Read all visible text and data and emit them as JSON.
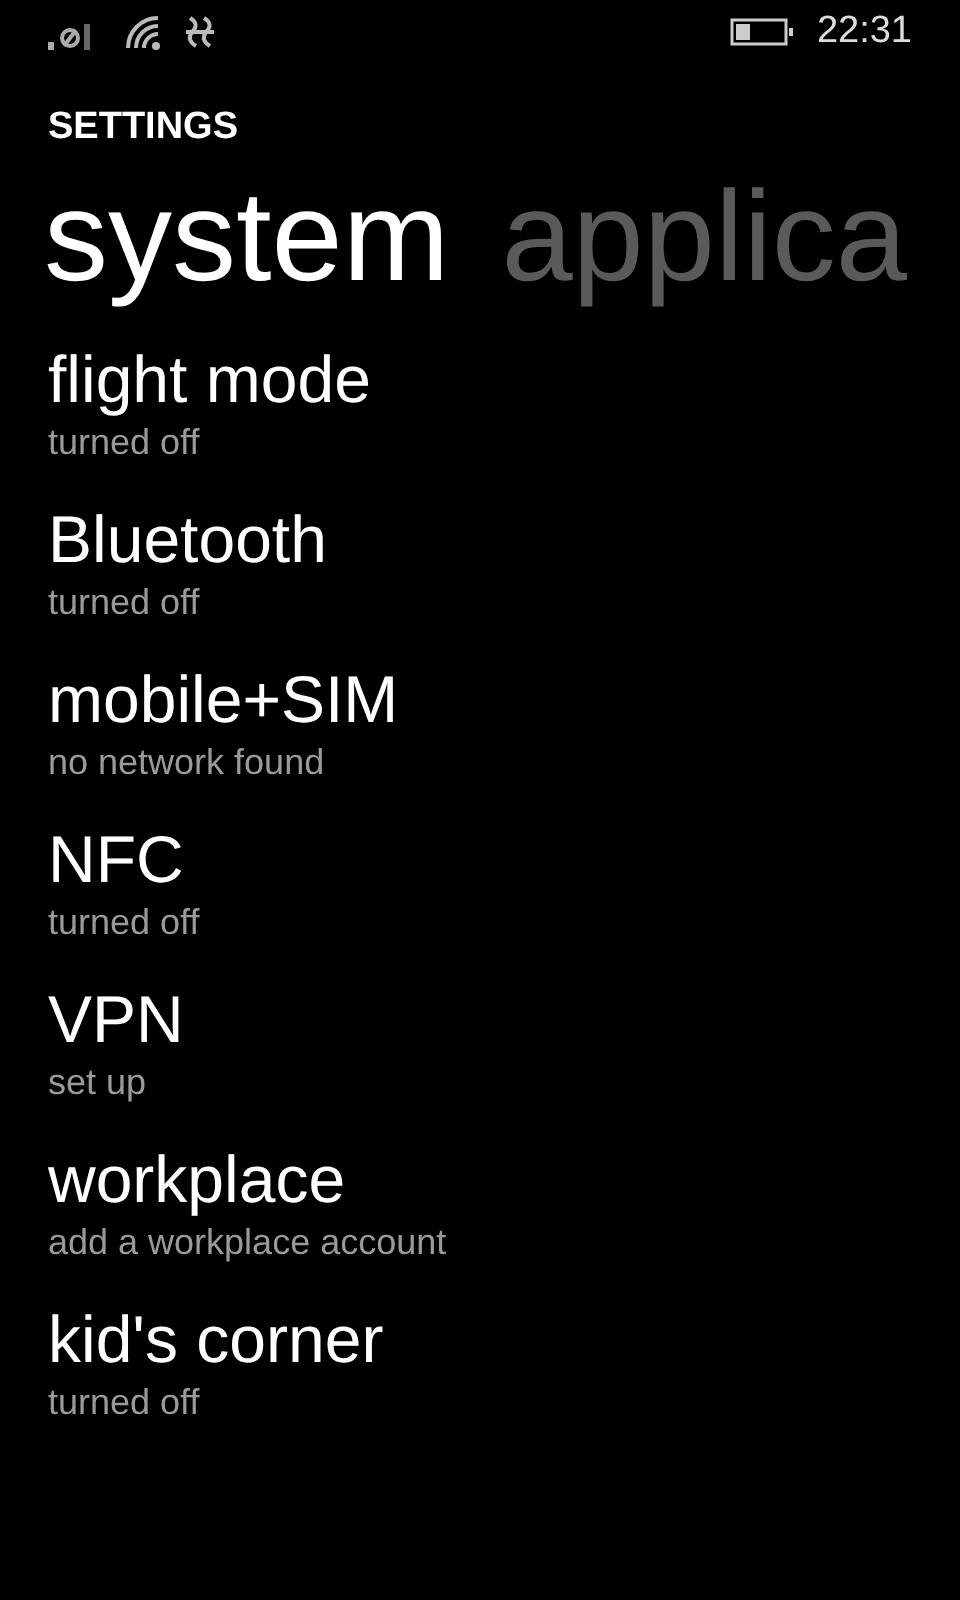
{
  "status_bar": {
    "time": "22:31"
  },
  "app_title": "SETTINGS",
  "pivots": [
    {
      "label": "system",
      "selected": true
    },
    {
      "label": "applica",
      "selected": false
    }
  ],
  "items": [
    {
      "title": "flight mode",
      "subtitle": "turned off"
    },
    {
      "title": "Bluetooth",
      "subtitle": "turned off"
    },
    {
      "title": "mobile+SIM",
      "subtitle": "no network found"
    },
    {
      "title": "NFC",
      "subtitle": "turned off"
    },
    {
      "title": "VPN",
      "subtitle": "set up"
    },
    {
      "title": "workplace",
      "subtitle": "add a workplace account"
    },
    {
      "title": "kid's corner",
      "subtitle": "turned off"
    }
  ]
}
